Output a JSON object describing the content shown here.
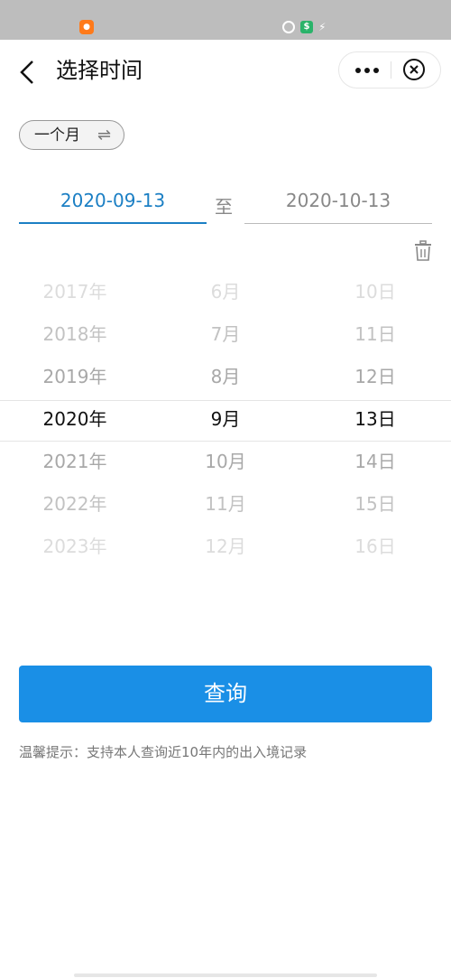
{
  "status_bar": {
    "icons": [
      "app-icon",
      "alarm-icon",
      "dollar-icon",
      "charging-icon"
    ]
  },
  "header": {
    "title": "选择时间",
    "icons": [
      "back-chevron-icon",
      "more-dots-icon",
      "close-circle-icon"
    ]
  },
  "range_selector": {
    "label": "一个月",
    "icon": "swap-arrows-icon"
  },
  "date_range": {
    "start": "2020-09-13",
    "separator": "至",
    "end": "2020-10-13",
    "clear_icon": "trash-icon"
  },
  "picker": {
    "years": [
      "2017年",
      "2018年",
      "2019年",
      "2020年",
      "2021年",
      "2022年",
      "2023年"
    ],
    "months": [
      "6月",
      "7月",
      "8月",
      "9月",
      "10月",
      "11月",
      "12月"
    ],
    "days": [
      "10日",
      "11日",
      "12日",
      "13日",
      "14日",
      "15日",
      "16日"
    ],
    "selected": {
      "year": "2020年",
      "month": "9月",
      "day": "13日"
    }
  },
  "query_button": {
    "label": "查询"
  },
  "tip": "温馨提示：支持本人查询近10年内的出入境记录",
  "colors": {
    "accent": "#1a8fe6",
    "active_date": "#1b7fc4",
    "status_bar": "#bdbdbd"
  }
}
